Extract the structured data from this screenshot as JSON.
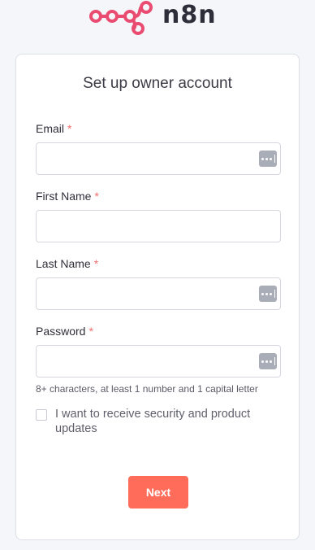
{
  "brand": {
    "name": "n8n",
    "color": "#ea4b71"
  },
  "form": {
    "title": "Set up owner account",
    "required_marker": "*",
    "fields": {
      "email": {
        "label": "Email",
        "value": "",
        "icon": "password-manager-icon"
      },
      "first_name": {
        "label": "First Name",
        "value": ""
      },
      "last_name": {
        "label": "Last Name",
        "value": "",
        "icon": "password-manager-icon"
      },
      "password": {
        "label": "Password",
        "value": "",
        "icon": "password-manager-icon"
      }
    },
    "password_hint": "8+ characters, at least 1 number and 1 capital letter",
    "updates_checkbox": {
      "label": "I want to receive security and product updates",
      "checked": false
    },
    "next_label": "Next",
    "accent_color": "#ff6d5a"
  }
}
